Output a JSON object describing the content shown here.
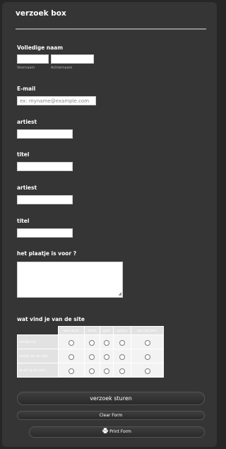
{
  "form": {
    "title": "verzoek box"
  },
  "full_name": {
    "label": "Volledige naam",
    "first_sublabel": "Voornaam",
    "last_sublabel": "Achternaam",
    "first_value": "",
    "last_value": ""
  },
  "email": {
    "label": "E-mail",
    "placeholder": "ex: myname@example.com",
    "value": ""
  },
  "fields": [
    {
      "label": "artiest",
      "value": ""
    },
    {
      "label": "titel",
      "value": ""
    },
    {
      "label": "artiest",
      "value": ""
    },
    {
      "label": "titel",
      "value": ""
    }
  ],
  "dedication": {
    "label": "het plaatje is voor ?",
    "value": ""
  },
  "rating": {
    "label": "wat vind je van de site",
    "columns": [
      "zeer slecht",
      "slecht",
      "goed",
      "perfect",
      "kan niet beter"
    ],
    "rows": [
      "uiterlijk site",
      "muziek van de radio",
      "de dj's op de radio"
    ]
  },
  "buttons": {
    "submit": "verzoek sturen",
    "clear": "Clear Form",
    "print": "Print Form"
  },
  "icons": {
    "print": "printer-icon",
    "resize": "resize-handle-icon"
  },
  "colors": {
    "background": "#262626",
    "panel": "#353535",
    "matrix_header": "#e2e2e2",
    "matrix_cell": "#f3f3f3"
  }
}
